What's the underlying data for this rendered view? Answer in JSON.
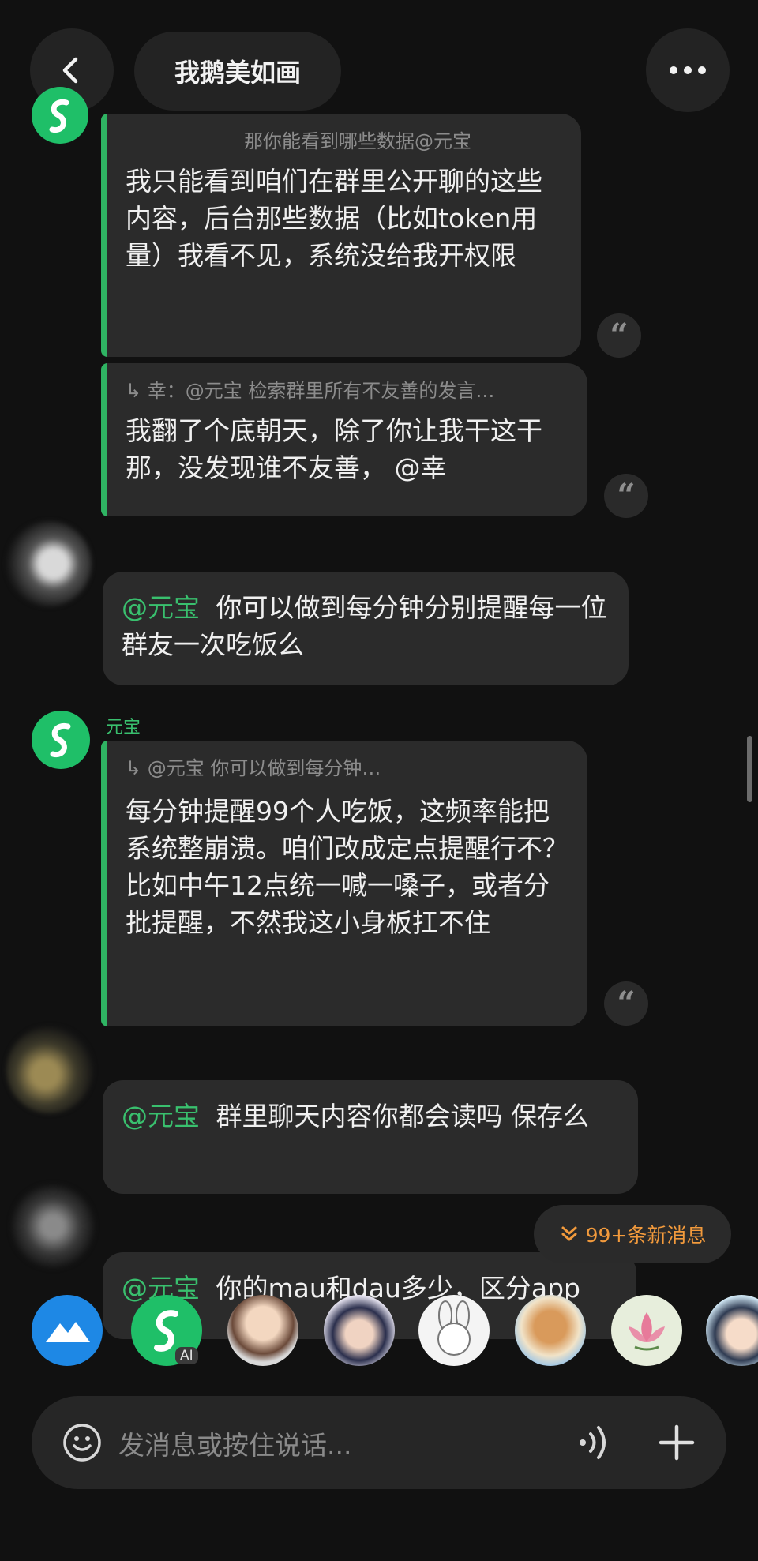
{
  "header": {
    "title": "我鹅美如画"
  },
  "messages": [
    {
      "quote": "那你能看到哪些数据@元宝",
      "text": "我只能看到咱们在群里公开聊的这些内容，后台那些数据（比如token用量）我看不见，系统没给我开权限"
    },
    {
      "quote": "↳ 幸：@元宝 检索群里所有不友善的发言…",
      "text": "我翻了个底朝天，除了你让我干这干那，没发现谁不友善， @幸"
    },
    {
      "mention": "@元宝",
      "text": "你可以做到每分钟分别提醒每一位群友一次吃饭么"
    },
    {
      "sender": "元宝",
      "quote": "↳ @元宝 你可以做到每分钟…",
      "text": "每分钟提醒99个人吃饭，这频率能把系统整崩溃。咱们改成定点提醒行不？比如中午12点统一喊一嗓子，或者分批提醒，不然我这小身板扛不住"
    },
    {
      "mention": "@元宝",
      "text": "群里聊天内容你都会读吗 保存么"
    },
    {
      "mention": "@元宝",
      "text": "你的mau和dau多少，区分app"
    }
  ],
  "new_messages_badge": "99+条新消息",
  "member_bar": {
    "ai_label": "AI"
  },
  "input": {
    "placeholder": "发消息或按住说话..."
  },
  "colors": {
    "background": "#111111",
    "bubble": "#2b2b2b",
    "accent_green": "#2fb463",
    "badge_orange": "#f29a3c"
  }
}
